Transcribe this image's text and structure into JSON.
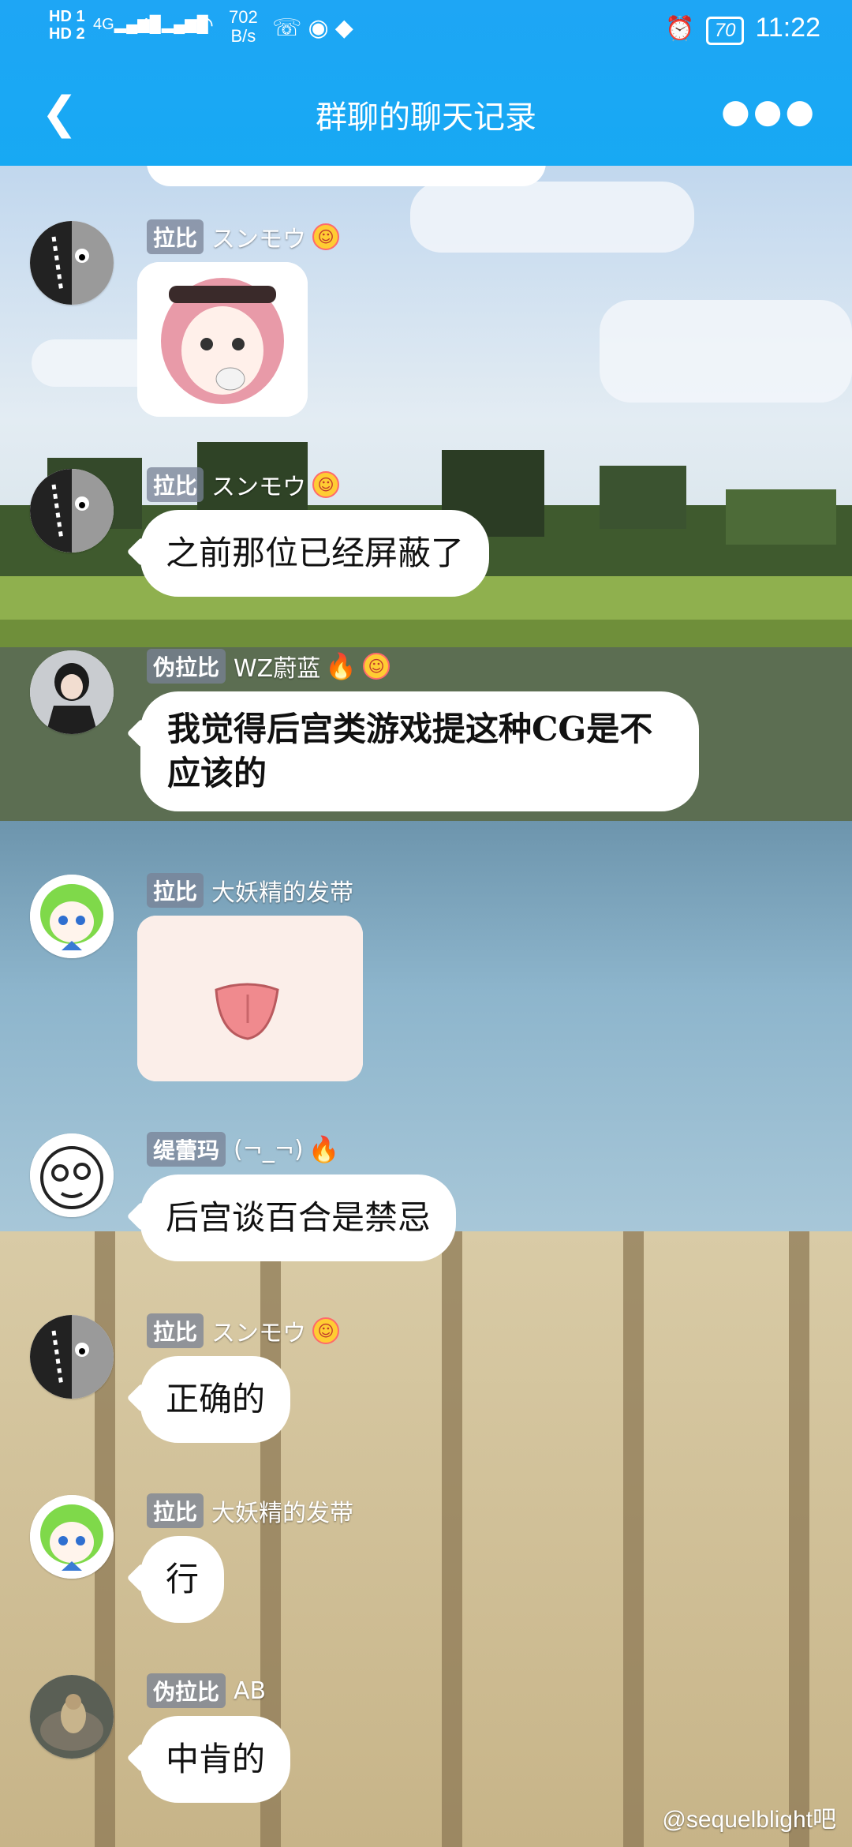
{
  "status_bar": {
    "hd1": "HD 1",
    "hd2": "HD 2",
    "net1": "4G",
    "net2": "4G",
    "speed_value": "702",
    "speed_unit": "B/s",
    "battery": "70",
    "time": "11:22"
  },
  "header": {
    "title": "群聊的聊天记录"
  },
  "messages": [
    {
      "tag": "拉比",
      "name": "スンモウ",
      "type": "sticker"
    },
    {
      "tag": "拉比",
      "name": "スンモウ",
      "type": "text",
      "text": "之前那位已经屏蔽了"
    },
    {
      "tag": "伪拉比",
      "name": "WZ蔚蓝",
      "type": "text",
      "text_line1": "我觉得后宫类游戏提这种CG是不",
      "text_line2": "应该的"
    },
    {
      "tag": "拉比",
      "name": "大妖精的发带",
      "type": "sticker"
    },
    {
      "tag": "缇蕾玛",
      "name": "(¬_¬)",
      "type": "text",
      "text": "后宫谈百合是禁忌"
    },
    {
      "tag": "拉比",
      "name": "スンモウ",
      "type": "text",
      "text": "正确的"
    },
    {
      "tag": "拉比",
      "name": "大妖精的发带",
      "type": "text",
      "text": "行"
    },
    {
      "tag": "伪拉比",
      "name": "AB",
      "type": "text",
      "text": "中肯的"
    }
  ],
  "watermark": "@sequelblight吧",
  "colors": {
    "header": "#17a9f3",
    "bubble": "#ffffff",
    "tag_bg": "#7882966b"
  },
  "icons": [
    "back-arrow-icon",
    "more-icon",
    "alarm-icon",
    "wifi-icon",
    "wechat-icon",
    "emoji-badge-icon",
    "fire-icon"
  ]
}
